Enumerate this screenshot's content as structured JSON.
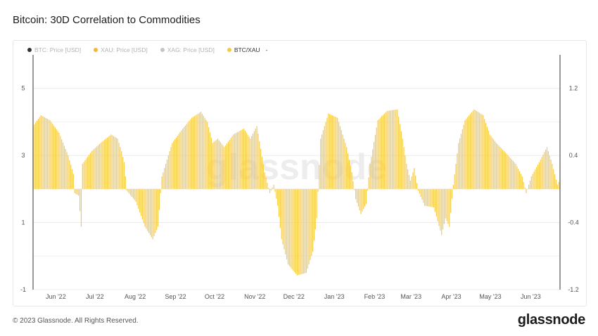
{
  "title": "Bitcoin: 30D Correlation to Commodities",
  "legend": [
    {
      "label": "BTC: Price [USD]",
      "color": "#333333",
      "active": false
    },
    {
      "label": "XAU: Price [USD]",
      "color": "#f2b833",
      "active": false
    },
    {
      "label": "XAG: Price [USD]",
      "color": "#c4c4c4",
      "active": false
    },
    {
      "label": "BTC/XAU",
      "color": "#f6c945",
      "active": true
    }
  ],
  "legend_dash": "-",
  "watermark": "glassnode",
  "footer": "© 2023 Glassnode. All Rights Reserved.",
  "brand": "glassnode",
  "colors": {
    "bar": "#f6c945",
    "grid": "#ececec",
    "axis": "#333333"
  },
  "chart_data": {
    "type": "bar",
    "title": "Bitcoin: 30D Correlation to Commodities",
    "series": [
      {
        "name": "BTC/XAU",
        "values": []
      }
    ],
    "x_range": [
      "2022-05-21",
      "2023-06-30"
    ],
    "x_ticks": [
      "Jun '22",
      "Jul '22",
      "Aug '22",
      "Sep '22",
      "Oct '22",
      "Nov '22",
      "Dec '22",
      "Jan '23",
      "Feb '23",
      "Mar '23",
      "Apr '23",
      "May '23",
      "Jun '23"
    ],
    "y_left_ticks": [
      "5",
      "3",
      "1",
      "-1"
    ],
    "y_right_ticks": [
      "1.2",
      "0.4",
      "-0.4",
      "-1.2"
    ],
    "y_left_range": [
      -1,
      6
    ],
    "y_right_range": [
      -1.2,
      1.6
    ],
    "keypoints": [
      [
        "2022-05-21",
        0.75
      ],
      [
        "2022-05-27",
        0.88
      ],
      [
        "2022-06-03",
        0.82
      ],
      [
        "2022-06-10",
        0.67
      ],
      [
        "2022-06-17",
        0.4
      ],
      [
        "2022-06-21",
        0.18
      ],
      [
        "2022-06-22",
        -0.05
      ],
      [
        "2022-06-25",
        -0.08
      ],
      [
        "2022-06-27",
        -0.45
      ],
      [
        "2022-06-28",
        0.3
      ],
      [
        "2022-07-05",
        0.45
      ],
      [
        "2022-07-12",
        0.55
      ],
      [
        "2022-07-20",
        0.65
      ],
      [
        "2022-07-25",
        0.6
      ],
      [
        "2022-07-28",
        0.45
      ],
      [
        "2022-07-30",
        0.32
      ],
      [
        "2022-08-01",
        -0.02
      ],
      [
        "2022-08-08",
        -0.15
      ],
      [
        "2022-08-15",
        -0.45
      ],
      [
        "2022-08-21",
        -0.6
      ],
      [
        "2022-08-25",
        -0.45
      ],
      [
        "2022-08-28",
        0.15
      ],
      [
        "2022-09-05",
        0.55
      ],
      [
        "2022-09-12",
        0.7
      ],
      [
        "2022-09-20",
        0.85
      ],
      [
        "2022-09-27",
        0.92
      ],
      [
        "2022-10-02",
        0.8
      ],
      [
        "2022-10-06",
        0.55
      ],
      [
        "2022-10-10",
        0.6
      ],
      [
        "2022-10-15",
        0.5
      ],
      [
        "2022-10-22",
        0.65
      ],
      [
        "2022-10-30",
        0.72
      ],
      [
        "2022-11-04",
        0.6
      ],
      [
        "2022-11-09",
        0.75
      ],
      [
        "2022-11-12",
        0.48
      ],
      [
        "2022-11-15",
        0.2
      ],
      [
        "2022-11-19",
        -0.05
      ],
      [
        "2022-11-22",
        0.05
      ],
      [
        "2022-11-25",
        -0.2
      ],
      [
        "2022-11-28",
        -0.6
      ],
      [
        "2022-12-03",
        -0.9
      ],
      [
        "2022-12-10",
        -1.03
      ],
      [
        "2022-12-17",
        -1.0
      ],
      [
        "2022-12-22",
        -0.75
      ],
      [
        "2022-12-25",
        -0.35
      ],
      [
        "2022-12-28",
        0.6
      ],
      [
        "2023-01-03",
        0.9
      ],
      [
        "2023-01-10",
        0.85
      ],
      [
        "2023-01-17",
        0.5
      ],
      [
        "2023-01-21",
        0.2
      ],
      [
        "2023-01-24",
        -0.12
      ],
      [
        "2023-01-28",
        -0.3
      ],
      [
        "2023-02-01",
        -0.18
      ],
      [
        "2023-02-04",
        0.3
      ],
      [
        "2023-02-10",
        0.82
      ],
      [
        "2023-02-17",
        0.93
      ],
      [
        "2023-02-25",
        0.95
      ],
      [
        "2023-03-01",
        0.6
      ],
      [
        "2023-03-04",
        0.3
      ],
      [
        "2023-03-07",
        0.1
      ],
      [
        "2023-03-10",
        0.25
      ],
      [
        "2023-03-13",
        -0.02
      ],
      [
        "2023-03-18",
        -0.2
      ],
      [
        "2023-03-25",
        -0.22
      ],
      [
        "2023-03-31",
        -0.55
      ],
      [
        "2023-04-03",
        -0.35
      ],
      [
        "2023-04-06",
        -0.45
      ],
      [
        "2023-04-09",
        0.05
      ],
      [
        "2023-04-13",
        0.55
      ],
      [
        "2023-04-18",
        0.82
      ],
      [
        "2023-04-25",
        0.95
      ],
      [
        "2023-05-02",
        0.88
      ],
      [
        "2023-05-07",
        0.65
      ],
      [
        "2023-05-12",
        0.55
      ],
      [
        "2023-05-20",
        0.42
      ],
      [
        "2023-05-27",
        0.3
      ],
      [
        "2023-06-01",
        0.15
      ],
      [
        "2023-06-04",
        -0.05
      ],
      [
        "2023-06-08",
        0.15
      ],
      [
        "2023-06-14",
        0.32
      ],
      [
        "2023-06-20",
        0.5
      ],
      [
        "2023-06-24",
        0.3
      ],
      [
        "2023-06-28",
        0.05
      ],
      [
        "2023-06-30",
        0.12
      ]
    ]
  }
}
